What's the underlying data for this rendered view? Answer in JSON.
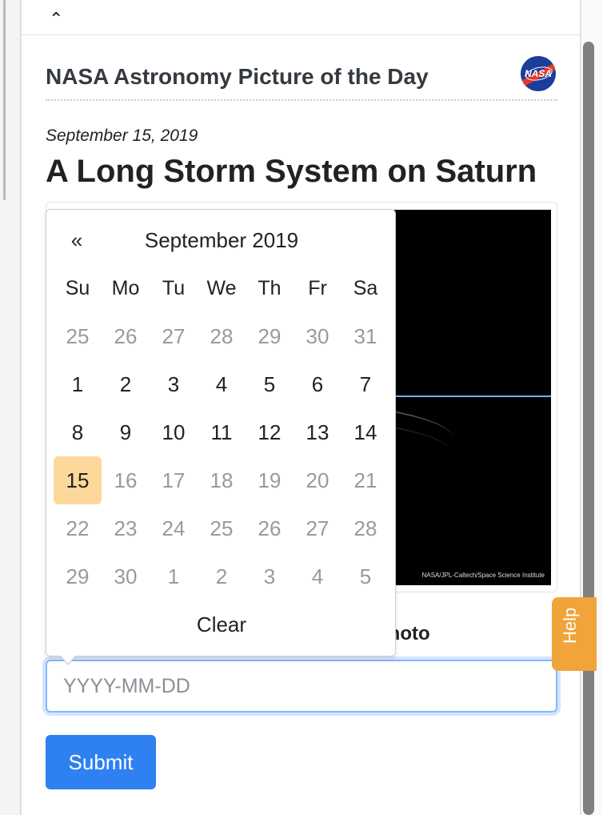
{
  "panel": {
    "collapse_icon": "chevron-up-icon",
    "title": "NASA Astronomy Picture of the Day",
    "logo_text": "NASA"
  },
  "apod": {
    "date": "September 15, 2019",
    "headline": "A Long Storm System on Saturn",
    "image_credit": "NASA/JPL-Caltech/Space Science Institute"
  },
  "form": {
    "label_visible_tail": "photo",
    "date_placeholder": "YYYY-MM-DD",
    "submit_label": "Submit"
  },
  "help": {
    "label": "Help"
  },
  "datepicker": {
    "prev_label": "«",
    "month_title": "September 2019",
    "weekdays": [
      "Su",
      "Mo",
      "Tu",
      "We",
      "Th",
      "Fr",
      "Sa"
    ],
    "days": [
      {
        "d": "25",
        "muted": true
      },
      {
        "d": "26",
        "muted": true
      },
      {
        "d": "27",
        "muted": true
      },
      {
        "d": "28",
        "muted": true
      },
      {
        "d": "29",
        "muted": true
      },
      {
        "d": "30",
        "muted": true
      },
      {
        "d": "31",
        "muted": true
      },
      {
        "d": "1"
      },
      {
        "d": "2"
      },
      {
        "d": "3"
      },
      {
        "d": "4"
      },
      {
        "d": "5"
      },
      {
        "d": "6"
      },
      {
        "d": "7"
      },
      {
        "d": "8"
      },
      {
        "d": "9"
      },
      {
        "d": "10"
      },
      {
        "d": "11"
      },
      {
        "d": "12"
      },
      {
        "d": "13"
      },
      {
        "d": "14"
      },
      {
        "d": "15",
        "selected": true
      },
      {
        "d": "16",
        "muted": true
      },
      {
        "d": "17",
        "muted": true
      },
      {
        "d": "18",
        "muted": true
      },
      {
        "d": "19",
        "muted": true
      },
      {
        "d": "20",
        "muted": true
      },
      {
        "d": "21",
        "muted": true
      },
      {
        "d": "22",
        "muted": true
      },
      {
        "d": "23",
        "muted": true
      },
      {
        "d": "24",
        "muted": true
      },
      {
        "d": "25",
        "muted": true
      },
      {
        "d": "26",
        "muted": true
      },
      {
        "d": "27",
        "muted": true
      },
      {
        "d": "28",
        "muted": true
      },
      {
        "d": "29",
        "muted": true
      },
      {
        "d": "30",
        "muted": true
      },
      {
        "d": "1",
        "muted": true
      },
      {
        "d": "2",
        "muted": true
      },
      {
        "d": "3",
        "muted": true
      },
      {
        "d": "4",
        "muted": true
      },
      {
        "d": "5",
        "muted": true
      }
    ],
    "clear_label": "Clear",
    "selected_color": "#fcd99a"
  },
  "colors": {
    "accent": "#2f80f0",
    "help_tab": "#f0a43a",
    "input_focus": "#86b7fe"
  }
}
